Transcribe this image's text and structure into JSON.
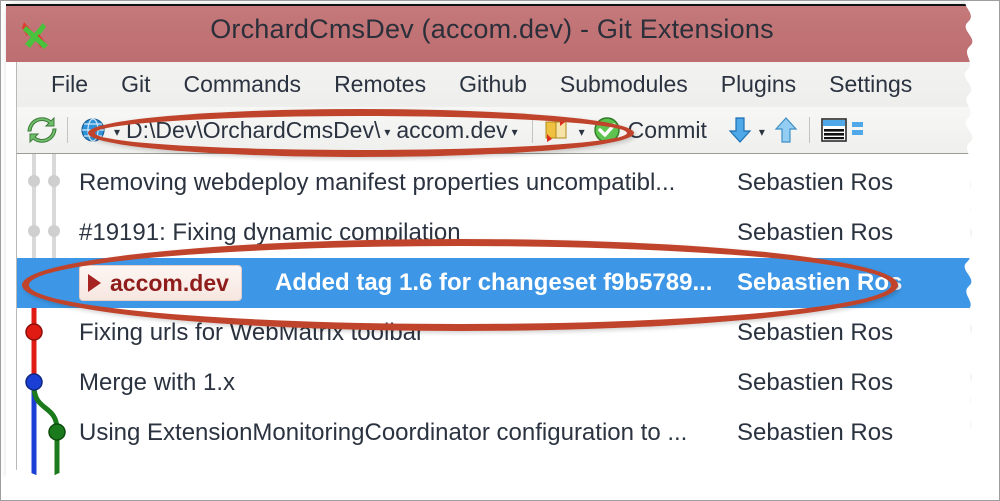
{
  "window": {
    "title": "OrchardCmsDev (accom.dev) - Git Extensions",
    "app_icon": "git-extensions-logo-icon",
    "titlebar_color": "#c07274"
  },
  "menubar": {
    "items": [
      {
        "label": "File"
      },
      {
        "label": "Git"
      },
      {
        "label": "Commands"
      },
      {
        "label": "Remotes"
      },
      {
        "label": "Github"
      },
      {
        "label": "Submodules"
      },
      {
        "label": "Plugins"
      },
      {
        "label": "Settings"
      }
    ]
  },
  "toolbar": {
    "refresh_icon": "refresh-icon",
    "globe_icon": "globe-icon",
    "repo_path": "D:\\Dev\\OrchardCmsDev\\",
    "branch": "accom.dev",
    "stash_icon": "stash-icon",
    "commit_icon": "commit-check-icon",
    "commit_label": "Commit",
    "pull_icon": "pull-down-arrow-icon",
    "push_icon": "push-up-arrow-icon",
    "panel_icon": "toggle-panel-icon",
    "dropdown_caret": "▾"
  },
  "grid": {
    "rows": [
      {
        "message": "Removing webdeploy manifest properties uncompatibl...",
        "author": "Sebastien Ros",
        "selected": false,
        "node": {
          "shape": "dot",
          "color": "#c9c9c9",
          "lane": 1
        }
      },
      {
        "message": "#19191: Fixing dynamic compilation",
        "author": "Sebastien Ros",
        "selected": false,
        "node": {
          "shape": "dot",
          "color": "#c9c9c9",
          "lane": 1
        }
      },
      {
        "message": "Added tag 1.6 for changeset f9b5789...",
        "author": "Sebastien Ros",
        "selected": true,
        "branch_label": "accom.dev",
        "node": {
          "shape": "square",
          "color": "#e01b14",
          "lane": 0
        }
      },
      {
        "message": "Fixing urls for WebMatrix toolbar",
        "author": "Sebastien Ros",
        "selected": false,
        "node": {
          "shape": "dot",
          "color": "#e01b14",
          "lane": 0
        }
      },
      {
        "message": "Merge with 1.x",
        "author": "Sebastien Ros",
        "selected": false,
        "node": {
          "shape": "dot",
          "color": "#1b3fd4",
          "lane": 0
        }
      },
      {
        "message": "Using ExtensionMonitoringCoordinator configuration to ...",
        "author": "Sebastien Ros",
        "selected": false,
        "node": {
          "shape": "dot",
          "color": "#1b7a1b",
          "lane": 2
        }
      }
    ],
    "selection_color": "#3d97e6"
  },
  "annotations": {
    "color": "#c0442c",
    "highlight_path_and_branch": "toolbar repository path and branch selector",
    "highlight_selected_commit": "selected tag commit row"
  }
}
